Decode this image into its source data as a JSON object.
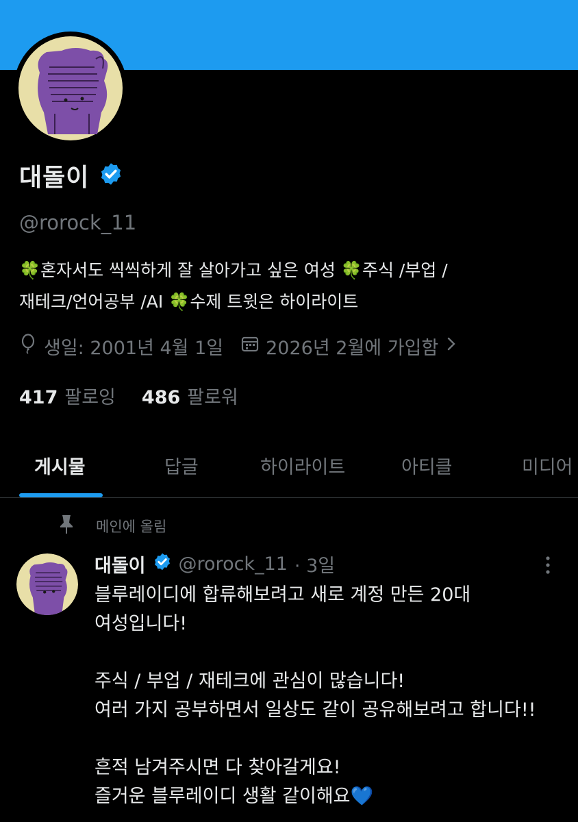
{
  "profile": {
    "name": "대돌이",
    "handle": "@rorock_11",
    "bio_line1": "🍀혼자서도 씩씩하게 잘 살아가고 싶은 여성  🍀주식 /부업 /",
    "bio_line2": "재테크/언어공부 /AI 🍀수제 트윗은 하이라이트",
    "birthday": "생일: 2001년 4월 1일",
    "joined": "2026년 2월에 가입함",
    "following_count": "417",
    "following_label": "팔로잉",
    "followers_count": "486",
    "followers_label": "팔로워",
    "icons": {
      "verified": "verified-badge-icon",
      "birthday": "balloon-icon",
      "joined": "calendar-icon",
      "chevron": "chevron-right-icon"
    },
    "colors": {
      "accent": "#1d9bf0",
      "muted": "#71767b",
      "background": "#000000"
    }
  },
  "tabs": [
    {
      "label": "게시물",
      "active": true
    },
    {
      "label": "답글"
    },
    {
      "label": "하이라이트"
    },
    {
      "label": "아티클"
    },
    {
      "label": "미디어"
    }
  ],
  "post": {
    "pinned_label": "메인에 올림",
    "author_name": "대돌이",
    "author_handle": "@rorock_11",
    "time": "· 3일",
    "lines": [
      "블루레이디에 합류해보려고 새로 계정 만든 20대",
      "여성입니다!",
      "",
      "주식 / 부업 / 재테크에 관심이 많습니다!",
      "여러 가지 공부하면서 일상도 같이 공유해보려고 합니다!!",
      "",
      "흔적 남겨주시면 다 찾아갈게요!",
      "즐거운 블루레이디 생활 같이해요💙"
    ]
  }
}
